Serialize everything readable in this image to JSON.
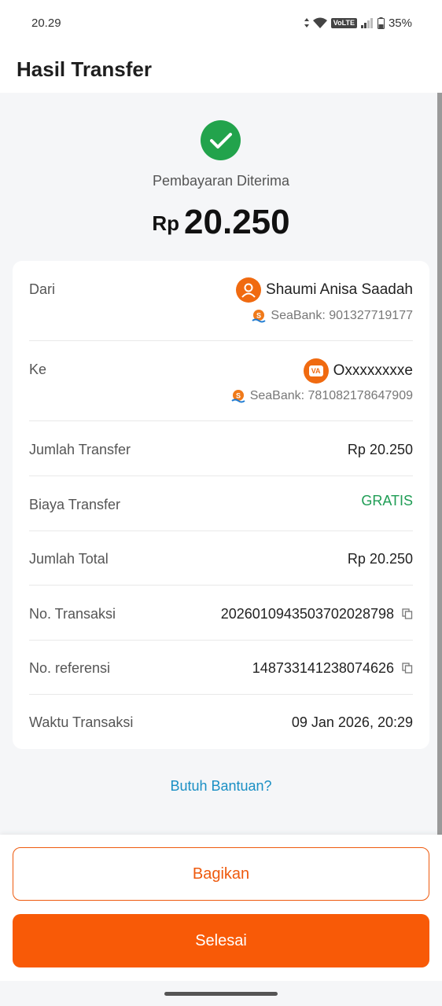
{
  "status_bar": {
    "time": "20.29",
    "volte": "VoLTE",
    "battery": "35%"
  },
  "header": {
    "title": "Hasil Transfer"
  },
  "hero": {
    "status": "Pembayaran Diterima",
    "currency": "Rp",
    "amount": "20.250"
  },
  "details": {
    "from": {
      "label": "Dari",
      "name": "Shaumi Anisa Saadah",
      "bank": "SeaBank: 901327719177"
    },
    "to": {
      "label": "Ke",
      "name": "Oxxxxxxxxe",
      "bank": "SeaBank: 781082178647909",
      "badge": "VA"
    },
    "rows": [
      {
        "label": "Jumlah Transfer",
        "value": "Rp 20.250"
      },
      {
        "label": "Biaya Transfer",
        "value": "GRATIS"
      },
      {
        "label": "Jumlah Total",
        "value": "Rp 20.250"
      },
      {
        "label": "No. Transaksi",
        "value": "202601094350370202879‌8"
      },
      {
        "label": "No. referensi",
        "value": "148733141238074626"
      },
      {
        "label": "Waktu Transaksi",
        "value": "09 Jan 2026, 20:29"
      }
    ]
  },
  "help_link": "Butuh Bantuan?",
  "buttons": {
    "share": "Bagikan",
    "done": "Selesai"
  },
  "colors": {
    "accent": "#f85a07",
    "success": "#22a34c",
    "link": "#1a8fc4"
  }
}
